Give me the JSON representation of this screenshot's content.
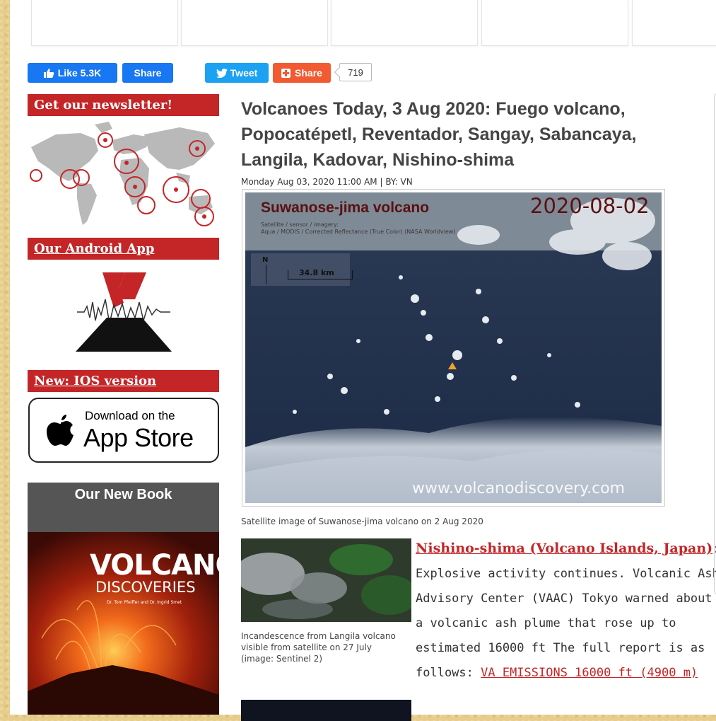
{
  "social": {
    "like_label": "Like 5.3K",
    "fb_share_label": "Share",
    "tweet_label": "Tweet",
    "share_label": "Share",
    "share_count": "719"
  },
  "sidebar": {
    "newsletter_heading": "Get our newsletter!",
    "android_heading": "Our Android App",
    "ios_heading": "New: IOS version",
    "appstore_small": "Download on the",
    "appstore_big": "App Store",
    "book_heading": "Our New Book",
    "book_title": "VOLCANO",
    "book_subtitle": "DISCOVERIES",
    "book_authors": "Dr. Tom Pfeiffer and Dr. Ingrid Smet"
  },
  "article": {
    "title": "Volcanoes Today, 3 Aug 2020: Fuego volcano, Popocatépetl, Reventador, Sangay, Sabancaya, Langila, Kadovar, Nishino-shima",
    "meta": "Monday Aug 03, 2020 11:00 AM | BY: VN",
    "figure": {
      "heading": "Suwanose-jima volcano",
      "date": "2020-08-02",
      "sensor_line1": "Satellite / sensor / imagery:",
      "sensor_line2": "Aqua / MODIS / Corrected Reflectance (True Color) (NASA Worldview)",
      "north": "N",
      "scale": "34.8 km",
      "watermark": "www.volcanodiscovery.com"
    },
    "caption": "Satellite image of Suwanose-jima volcano on 2 Aug 2020",
    "thumb_caption": "Incandescence from Langila volcano visible from satellite on 27 July (image: Sentinel 2)",
    "link_title": "Nishino-shima (Volcano Islands, Japan)",
    "text1": ": Explosive activity continues. Volcanic Ash Advisory Center (VAAC) Tokyo warned about a volcanic ash plume that rose up to estimated 16000 ft",
    "text2": " The full report is as follows: ",
    "link_report": "VA EMISSIONS 16000 ft (4900 m)"
  },
  "colors": {
    "sidebar_red": "#c42527",
    "facebook": "#1877f2",
    "twitter": "#1da1f2",
    "share_orange": "#f25a32",
    "title_gray": "#444444"
  }
}
